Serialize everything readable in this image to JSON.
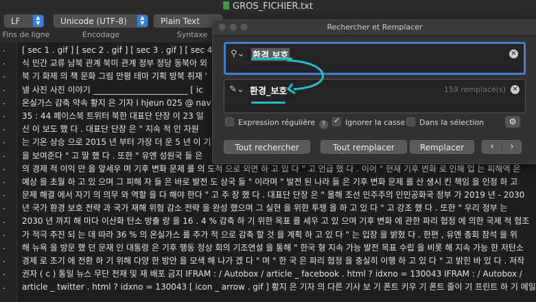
{
  "window": {
    "title": "GROS_FICHIER.txt"
  },
  "toolbar": {
    "line_ending": {
      "value": "LF",
      "label": "Fins de ligne"
    },
    "encoding": {
      "value": "Unicode (UTF-8)",
      "label": "Encodage"
    },
    "syntax": {
      "value": "Plain Text",
      "label": "Syntaxe"
    }
  },
  "editor": {
    "lines": [
      "[ sec 1 . gif ] [ sec 2 . gif ] [ sec 3 . gif ] [ sec 4 . g",
      "식 민간 교류 남북 관계 북미 관계 정부 정당 동북아 외",
      "북 기 화제 의 책 문화 그림 만평  테마 기획 방북 취재 '",
      "넬 사진 사진 이야기 _______________________ [ ic",
      "온실가스 감축 약속  황지 은 기자 l hjeun 025 @ nav",
      "35 : 44  페이스북 트위터   북한 대표단 단장 이 23 일",
      "신  이 보도 했 다 .  대표단 단장 은 \" 지속 적 인 자원",
      "는 기온 상승 으로 2015 년 부터 가장 더  운 5 년 이 기",
      "을 보여준다 \" 고 말 했 다 .   또한 \" 유엔 성원국 들 은",
      "의 경제 적 이익 만 을 앞세우 며 기후 변화 문제 를 의  도적 으로 외면 하 고 있 다 \" 고 언급 했 다 .   이어 \" 현재 기후 변화 로 인해 입 는 피해액 은",
      "예상 을 초월 하 고 있 으며 그 피해  자 들 은 바로 발전 도 상국 들 \" 이라며 \" 발전 된 나라 들 은 기후 변화 문제 를 산 생시  킨 책임 을 인정 하 고",
      "문제 해결 에서 자기 의 의무 와 역할 을 다 해야 한다 \" 고 주  장 했 다 .   대표단 단장 은 \" 올해 조선 민주주의 인민공화국 정부 가 2019 년 - 2030",
      "년 국가 환경  보호 전략 과 국가 재해 위험 감소 전략 을 완성 했으며 그 실현 을 위한 투쟁 을 하  고 있 다 \" 고 강조 했 다 .   또한 \" 우리 정부 는",
      "2030 년 까지 해 마다 이산화 탄소 방출 량 을 16 . 4 % 감축 하 기  위한 목표 를 세우 고 있 으며 기후 변화 에 관한 파리 협정 에 의한 국제 적 협조",
      "가  적극 추진 되 는 데 따라 36 % 의 온실가스 를 추가 적 으로 감축 할 것 을 계획 하 고  있 다 \" 는 입장 을 밝혔 다 .   한편 , 유엔 총회 참석 을 위",
      "해 뉴욕 을 방문 했 던 문재 인 대통령 은 기후 행동 정상  회의 기조연설 을 통해 \" 한국 형 지속 가능 발전 목표 수립 을 비롯 해 지속 가능 한  저탄소",
      "경제 로 조기 에 전환 하 기 위해 다양 한 방안 을 모색 해 나가 겠 다 \" 며 \" 한  국 은 파리 협정 을 충실히 이행 하 고 있 다 \" 고 밝힌 바 있 다 .   저작",
      "권자 ( c ) 통일 뉴스 무단 전재 및 재 배포 금지    IFRAM : / Autobox / article _ facebook . html ? idxno = 130043   IFRAM : / Autobox /",
      "article _ twitter . html ? idxno = 130043   [ icon _ arrow . gif ] 황지 은 기자 의 다른 기사 보 기   폰트 키우 기 폰트 줄이 기 프린트 하 기 메일"
    ]
  },
  "dialog": {
    "title": "Rechercher et Remplacer",
    "search": {
      "value": "환경 보호",
      "icon": "magnifier-icon"
    },
    "replace": {
      "value": "환경_보호",
      "icon": "pencil-icon",
      "count": "159 remplacé(s)"
    },
    "options": {
      "regex": {
        "label": "Expression régulière",
        "checked": false
      },
      "ignore_case": {
        "label": "Ignorer la casse",
        "checked": true
      },
      "in_selection": {
        "label": "Dans la sélection",
        "checked": false
      }
    },
    "buttons": {
      "find_all": "Tout rechercher",
      "replace_all": "Tout remplacer",
      "replace": "Remplacer",
      "prev": "‹",
      "next": "›"
    }
  },
  "annotation": {
    "color": "#19c3d3"
  }
}
